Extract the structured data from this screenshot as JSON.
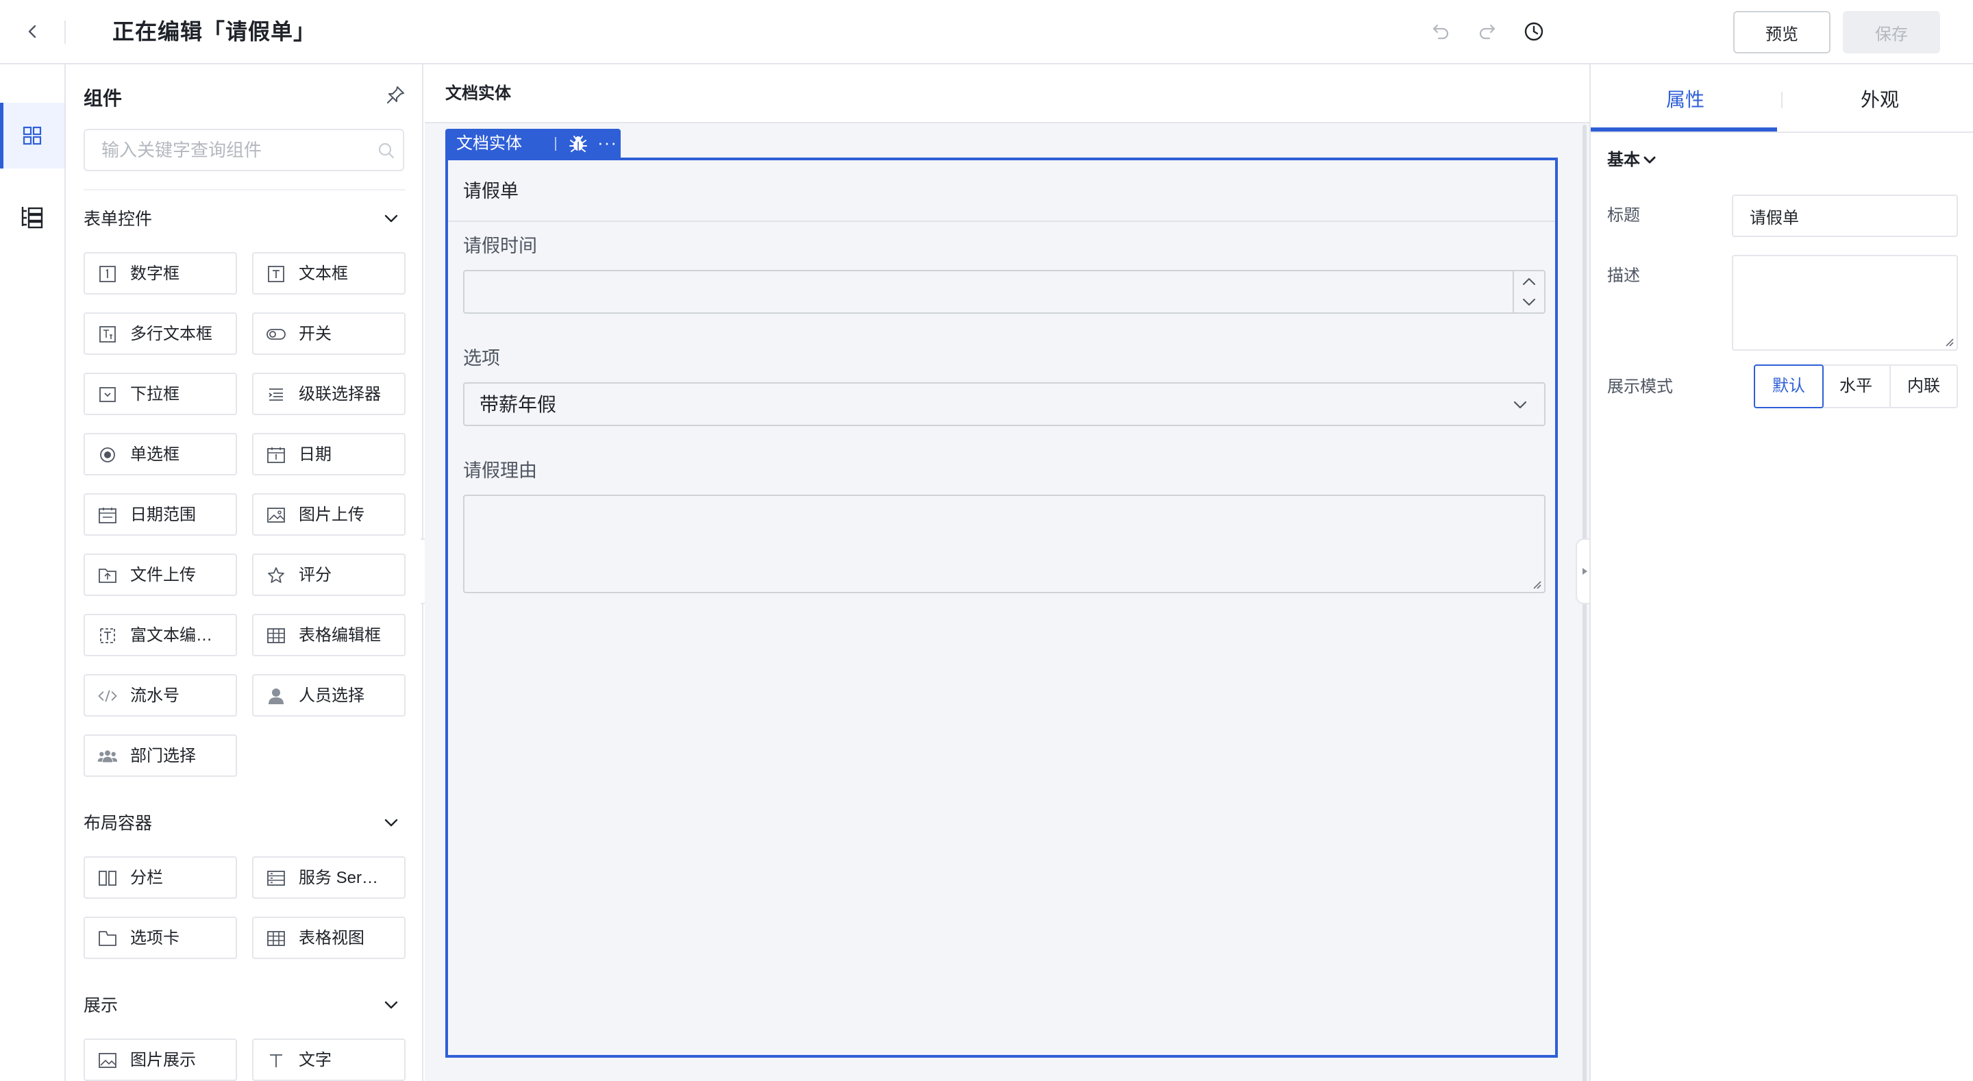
{
  "header": {
    "title": "正在编辑「请假单」",
    "preview_label": "预览",
    "save_label": "保存"
  },
  "rail": {
    "items": [
      {
        "icon": "components-grid-icon",
        "active": true
      },
      {
        "icon": "outline-tree-icon",
        "active": false
      }
    ]
  },
  "components_panel": {
    "title": "组件",
    "search_placeholder": "输入关键字查询组件",
    "groups": [
      {
        "name": "表单控件",
        "items": [
          "数字框",
          "文本框",
          "多行文本框",
          "开关",
          "下拉框",
          "级联选择器",
          "单选框",
          "日期",
          "日期范围",
          "图片上传",
          "文件上传",
          "评分",
          "富文本编…",
          "表格编辑框",
          "流水号",
          "人员选择",
          "部门选择"
        ]
      },
      {
        "name": "布局容器",
        "items": [
          "分栏",
          "服务 Ser…",
          "选项卡",
          "表格视图"
        ]
      },
      {
        "name": "展示",
        "items": [
          "图片展示",
          "文字"
        ]
      }
    ]
  },
  "canvas": {
    "header_label": "文档实体",
    "entity_tag": {
      "name": "文档实体",
      "more": "···"
    },
    "form": {
      "title": "请假单",
      "fields": [
        {
          "label": "请假时间",
          "type": "number",
          "value": ""
        },
        {
          "label": "选项",
          "type": "select",
          "value": "带薪年假"
        },
        {
          "label": "请假理由",
          "type": "textarea",
          "value": ""
        }
      ]
    }
  },
  "properties_panel": {
    "tabs": [
      {
        "label": "属性",
        "active": true
      },
      {
        "label": "外观",
        "active": false
      }
    ],
    "section": "基本",
    "title_label": "标题",
    "title_value": "请假单",
    "desc_label": "描述",
    "desc_value": "",
    "display_mode_label": "展示模式",
    "display_modes": [
      {
        "label": "默认",
        "active": true
      },
      {
        "label": "水平",
        "active": false
      },
      {
        "label": "内联",
        "active": false
      }
    ]
  },
  "colors": {
    "accent": "#2f5fd7",
    "canvas_bg": "#f4f5f8",
    "border": "#e5e6eb",
    "disabled_text": "#b4b8bf"
  }
}
